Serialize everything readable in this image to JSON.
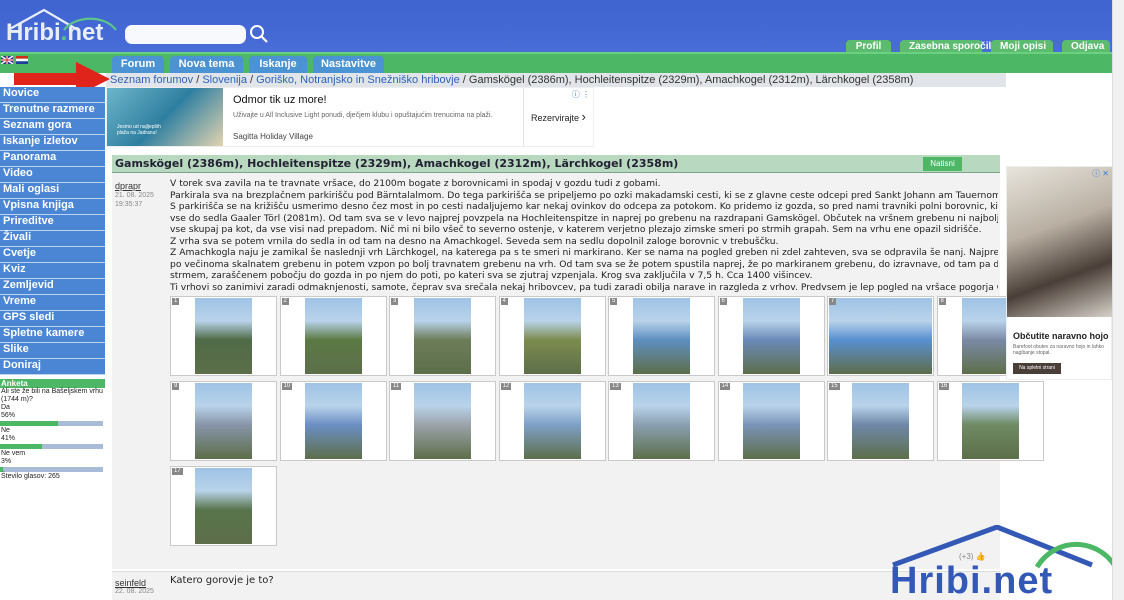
{
  "brand": {
    "logo_text": "Hribi",
    "logo_dot": ".",
    "logo_suffix": "net"
  },
  "search": {
    "placeholder": ""
  },
  "user_nav": [
    "Profil",
    "Zasebna sporočila",
    "Moji opisi",
    "Odjava"
  ],
  "main_tabs": [
    "Forum",
    "Nova tema",
    "Iskanje",
    "Nastavitve"
  ],
  "breadcrumb": {
    "links": [
      "Seznam forumov",
      "Slovenija",
      "Goriško, Notranjsko in Snežniško hribovje"
    ],
    "current": "Gamskögel (2386m), Hochleitenspitze (2329m), Amachkogel (2312m), Lärchkogel (2358m)",
    "separator": " / "
  },
  "sidebar": {
    "items": [
      "Novice",
      "Trenutne razmere",
      "Seznam gora",
      "Iskanje izletov",
      "Panorama",
      "Video",
      "Mali oglasi",
      "Vpisna knjiga",
      "Prireditve",
      "Živali",
      "Cvetje",
      "Kviz",
      "Zemljevid",
      "Vreme",
      "GPS sledi",
      "Spletne kamere",
      "Slike",
      "Doniraj"
    ]
  },
  "poll": {
    "title": "Anketa",
    "question": "Ali ste že bili na Bašeljskem vrhu (1744 m)?",
    "options": [
      {
        "label": "Da",
        "percent_text": "56%",
        "fraction": 0.56
      },
      {
        "label": "Ne",
        "percent_text": "41%",
        "fraction": 0.41
      },
      {
        "label": "Ne vem",
        "percent_text": "3%",
        "fraction": 0.03
      }
    ],
    "total": "Število glasov: 265"
  },
  "ad_top": {
    "title": "Odmor tik uz more!",
    "desc": "Uživajte u All Inclusive Light ponudi, dječjem klubu i opuštajućim trenucima na plaži.",
    "brand": "Sagitta Holiday Village",
    "cta": "Rezervirajte",
    "img_caption": "Jesmo ud najljepših plaža na Jadranu!"
  },
  "topic": {
    "title": "Gamskögel (2386m), Hochleitenspitze (2329m), Amachkogel (2312m), Lärchkogel (2358m)",
    "reply_label": "Natisni"
  },
  "post1": {
    "user": "dprapr",
    "date": "21. 08. 2025",
    "time": "19:35:37",
    "lines": [
      "V torek sva zavila na te travnate vršace, do 2100m bogate z borovnicami in spodaj v gozdu tudi z gobami.",
      "Parkirala sva na brezplačnem parkirišču pod Bärntalalmom. Do tega parkirišča se pripeljemo po ozki makadamski cesti, ki se z glavne ceste odcepi pred Sankt Johann am Tauernom.",
      "S parkirišča se na križišču usmerimo desno čez most in po cesti nadaljujemo kar nekaj ovinkov do odcepa za potokom. Ko pridemo iz gozda, so pred nami travniki polni borovnic, ki nas spremljajo",
      "vse do sedla Gaaler Törl (2081m). Od tam sva se v levo najprej povzpela na Hochleitenspitze in naprej po grebenu na razdrapani Gamskögel. Občutek na vršnem grebenu ni najboljši. Klada pri kladi,",
      "vse skupaj pa kot, da vse visi nad prepadom. Nič mi ni bilo všeč to severno ostenje, v katerem verjetno plezajo zimske smeri po strmih grapah. Sem na vrhu ene opazil sidrišče.",
      "Z vrha sva se potem vrnila do sedla in od tam na desno na Amachkogel. Seveda sem na sedlu dopolnil zaloge borovnic v trebuščku.",
      "Z Amachkogla naju je zamikal še naslednji vrh Lärchkogel, na katerega pa s te smeri ni markirano. Ker se nama na pogled greben ni zdel zahteven, sva se odpravila še nanj. Najprej spust cca 200m",
      "po večinoma skalnatem grebenu in potem vzpon po bolj travnatem grebenu na vrh. Od tam sva se že potem spustila naprej, že po markiranem grebenu, do izravnave, od tam pa desno navzdol po",
      "strmem, zaraščenem pobočju do gozda in po njem do poti, po kateri sva se zjutraj vzpenjala. Krog sva zaključila v 7,5 h. Cca 1400 višincev.",
      "Ti vrhovi so zanimivi zaradi odmaknjenosti, samote, čeprav sva srečala nekaj hribovcev, pa tudi zaradi obilja narave in razgleda z vrhov. Predvsem je lep pogled na vršace pogorja Gesause."
    ],
    "like_count": "(+3)"
  },
  "gallery": {
    "numbers": [
      "1",
      "2",
      "3",
      "4",
      "5",
      "6",
      "7",
      "8",
      "9",
      "10",
      "11",
      "12",
      "13",
      "14",
      "15",
      "16",
      "17"
    ],
    "colors": [
      "#4f6b47",
      "#5b7a44",
      "#6d7d5a",
      "#7c8c4e",
      "#5e8fbf",
      "#6b8ab8",
      "#5a8fd0",
      "#7b8aa5",
      "#8795a8",
      "#6b8fc4",
      "#9ba3a9",
      "#7fa0c7",
      "#8aa0b0",
      "#7a94b8",
      "#6f88a8",
      "#6f8a64",
      "#58744a"
    ]
  },
  "post2": {
    "user": "seinfeld",
    "date": "22. 08. 2025",
    "text": "Katero gorovje je to?"
  },
  "side_ad": {
    "title": "Občutite naravno hojo",
    "desc": "Barefoot obutev za naravno hojo in lahko nagibanje stopal.",
    "cta": "Na spletni strani"
  },
  "watermark": {
    "text": "Hribi.net"
  },
  "colors": {
    "header_blue": "#4166d0",
    "nav_green": "#4cb765",
    "sidebar_blue": "#4a86d4",
    "link_blue": "#2d63b6"
  }
}
